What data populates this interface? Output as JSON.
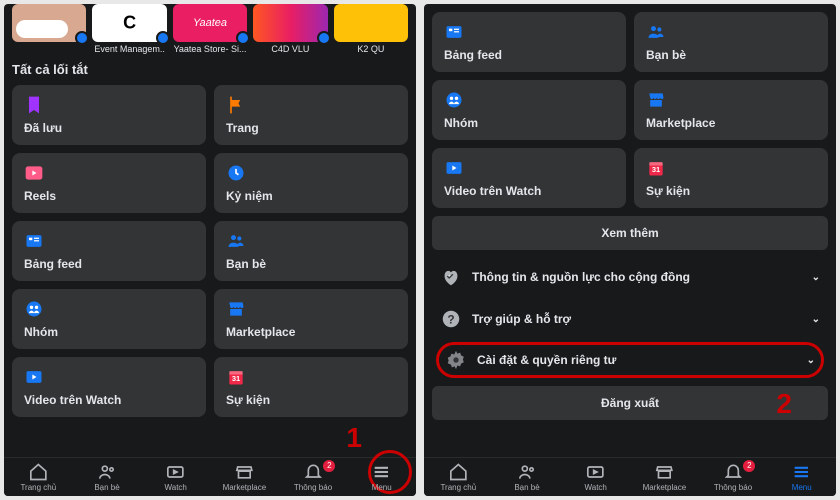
{
  "left": {
    "shortcuts": [
      "",
      "Event Managem..",
      "Yaatea Store- Si...",
      "C4D VLU",
      "K2\nQU"
    ],
    "section_title": "Tất cả lối tắt",
    "tiles": [
      {
        "icon": "bookmark",
        "label": "Đã lưu"
      },
      {
        "icon": "flag",
        "label": "Trang"
      },
      {
        "icon": "reels",
        "label": "Reels"
      },
      {
        "icon": "clock",
        "label": "Kỷ niệm"
      },
      {
        "icon": "feed",
        "label": "Bảng feed"
      },
      {
        "icon": "friends",
        "label": "Bạn bè"
      },
      {
        "icon": "groups",
        "label": "Nhóm"
      },
      {
        "icon": "marketplace",
        "label": "Marketplace"
      },
      {
        "icon": "watch",
        "label": "Video trên Watch"
      },
      {
        "icon": "events",
        "label": "Sự kiện"
      }
    ],
    "nav": [
      "Trang chủ",
      "Bạn bè",
      "Watch",
      "Marketplace",
      "Thông báo",
      "Menu"
    ],
    "badge": "2",
    "step": "1"
  },
  "right": {
    "tiles": [
      {
        "icon": "feed",
        "label": "Bảng feed"
      },
      {
        "icon": "friends",
        "label": "Bạn bè"
      },
      {
        "icon": "groups",
        "label": "Nhóm"
      },
      {
        "icon": "marketplace",
        "label": "Marketplace"
      },
      {
        "icon": "watch",
        "label": "Video trên Watch"
      },
      {
        "icon": "events",
        "label": "Sự kiện"
      }
    ],
    "see_more": "Xem thêm",
    "accordions": [
      {
        "icon": "community",
        "label": "Thông tin & nguồn lực cho cộng đồng"
      },
      {
        "icon": "help",
        "label": "Trợ giúp & hỗ trợ"
      },
      {
        "icon": "settings",
        "label": "Cài đặt & quyền riêng tư"
      }
    ],
    "logout": "Đăng xuất",
    "nav": [
      "Trang chủ",
      "Bạn bè",
      "Watch",
      "Marketplace",
      "Thông báo",
      "Menu"
    ],
    "badge": "2",
    "step": "2"
  }
}
